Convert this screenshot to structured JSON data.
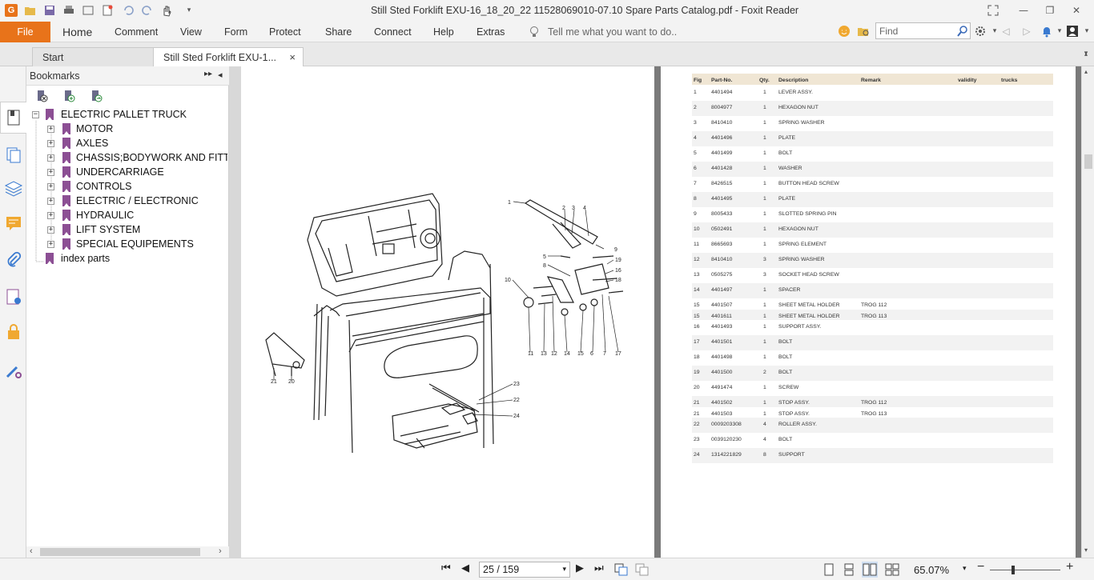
{
  "window": {
    "title": "Still Sted Forklift EXU-16_18_20_22 11528069010-07.10 Spare Parts Catalog.pdf - Foxit Reader",
    "logo": "G"
  },
  "ribbon": {
    "tabs": [
      "File",
      "Home",
      "Comment",
      "View",
      "Form",
      "Protect",
      "Share",
      "Connect",
      "Help",
      "Extras"
    ],
    "tell_me": "Tell me what you want to do..",
    "find_placeholder": "Find"
  },
  "doc_tabs": {
    "start": "Start",
    "active": "Still Sted Forklift EXU-1...",
    "close": "×"
  },
  "bookmarks": {
    "title": "Bookmarks",
    "root": "ELECTRIC PALLET TRUCK",
    "items": [
      "MOTOR",
      "AXLES",
      "CHASSIS;BODYWORK AND FITTINGS",
      "UNDERCARRIAGE",
      "CONTROLS",
      "ELECTRIC / ELECTRONIC",
      "HYDRAULIC",
      "LIFT SYSTEM",
      "SPECIAL EQUIPEMENTS"
    ],
    "last": "index parts"
  },
  "parts_table": {
    "headers": [
      "Fig",
      "Part-No.",
      "Qty.",
      "Description",
      "Remark",
      "validity",
      "trucks"
    ],
    "rows": [
      [
        "1",
        "4401494",
        "1",
        "LEVER ASSY.",
        ""
      ],
      [
        "2",
        "8004977",
        "1",
        "HEXAGON NUT",
        ""
      ],
      [
        "3",
        "8410410",
        "1",
        "SPRING WASHER",
        ""
      ],
      [
        "4",
        "4401496",
        "1",
        "PLATE",
        ""
      ],
      [
        "5",
        "4401499",
        "1",
        "BOLT",
        ""
      ],
      [
        "6",
        "4401428",
        "1",
        "WASHER",
        ""
      ],
      [
        "7",
        "8426515",
        "1",
        "BUTTON HEAD SCREW",
        ""
      ],
      [
        "8",
        "4401495",
        "1",
        "PLATE",
        ""
      ],
      [
        "9",
        "8005433",
        "1",
        "SLOTTED SPRING PIN",
        ""
      ],
      [
        "10",
        "0502491",
        "1",
        "HEXAGON NUT",
        ""
      ],
      [
        "11",
        "8665693",
        "1",
        "SPRING ELEMENT",
        ""
      ],
      [
        "12",
        "8410410",
        "3",
        "SPRING WASHER",
        ""
      ],
      [
        "13",
        "0505275",
        "3",
        "SOCKET HEAD SCREW",
        ""
      ],
      [
        "14",
        "4401497",
        "1",
        "SPACER",
        ""
      ],
      [
        "15",
        "4401507",
        "1",
        "SHEET METAL HOLDER",
        "TROG 112"
      ],
      [
        "15",
        "4401611",
        "1",
        "SHEET METAL HOLDER",
        "TROG 113"
      ],
      [
        "16",
        "4401493",
        "1",
        "SUPPORT ASSY.",
        ""
      ],
      [
        "17",
        "4401501",
        "1",
        "BOLT",
        ""
      ],
      [
        "18",
        "4401498",
        "1",
        "BOLT",
        ""
      ],
      [
        "19",
        "4401500",
        "2",
        "BOLT",
        ""
      ],
      [
        "20",
        "4491474",
        "1",
        "SCREW",
        ""
      ],
      [
        "21",
        "4401502",
        "1",
        "STOP ASSY.",
        "TROG 112"
      ],
      [
        "21",
        "4401503",
        "1",
        "STOP ASSY.",
        "TROG 113"
      ],
      [
        "22",
        "0009203308",
        "4",
        "ROLLER ASSY.",
        ""
      ],
      [
        "23",
        "0039120230",
        "4",
        "BOLT",
        ""
      ],
      [
        "24",
        "1314221829",
        "8",
        "SUPPORT",
        ""
      ]
    ]
  },
  "drawing_callouts": [
    "1",
    "2",
    "3",
    "4",
    "5",
    "6",
    "7",
    "8",
    "9",
    "10",
    "11",
    "12",
    "13",
    "14",
    "15",
    "16",
    "17",
    "18",
    "19",
    "20",
    "21",
    "22",
    "23",
    "24"
  ],
  "status": {
    "page": "25 / 159",
    "zoom": "65.07%",
    "zoom_fraction": 0.33
  },
  "colors": {
    "accent": "#e8731a",
    "bookmark": "#8c4f94",
    "table_header": "#f0e6d4"
  }
}
